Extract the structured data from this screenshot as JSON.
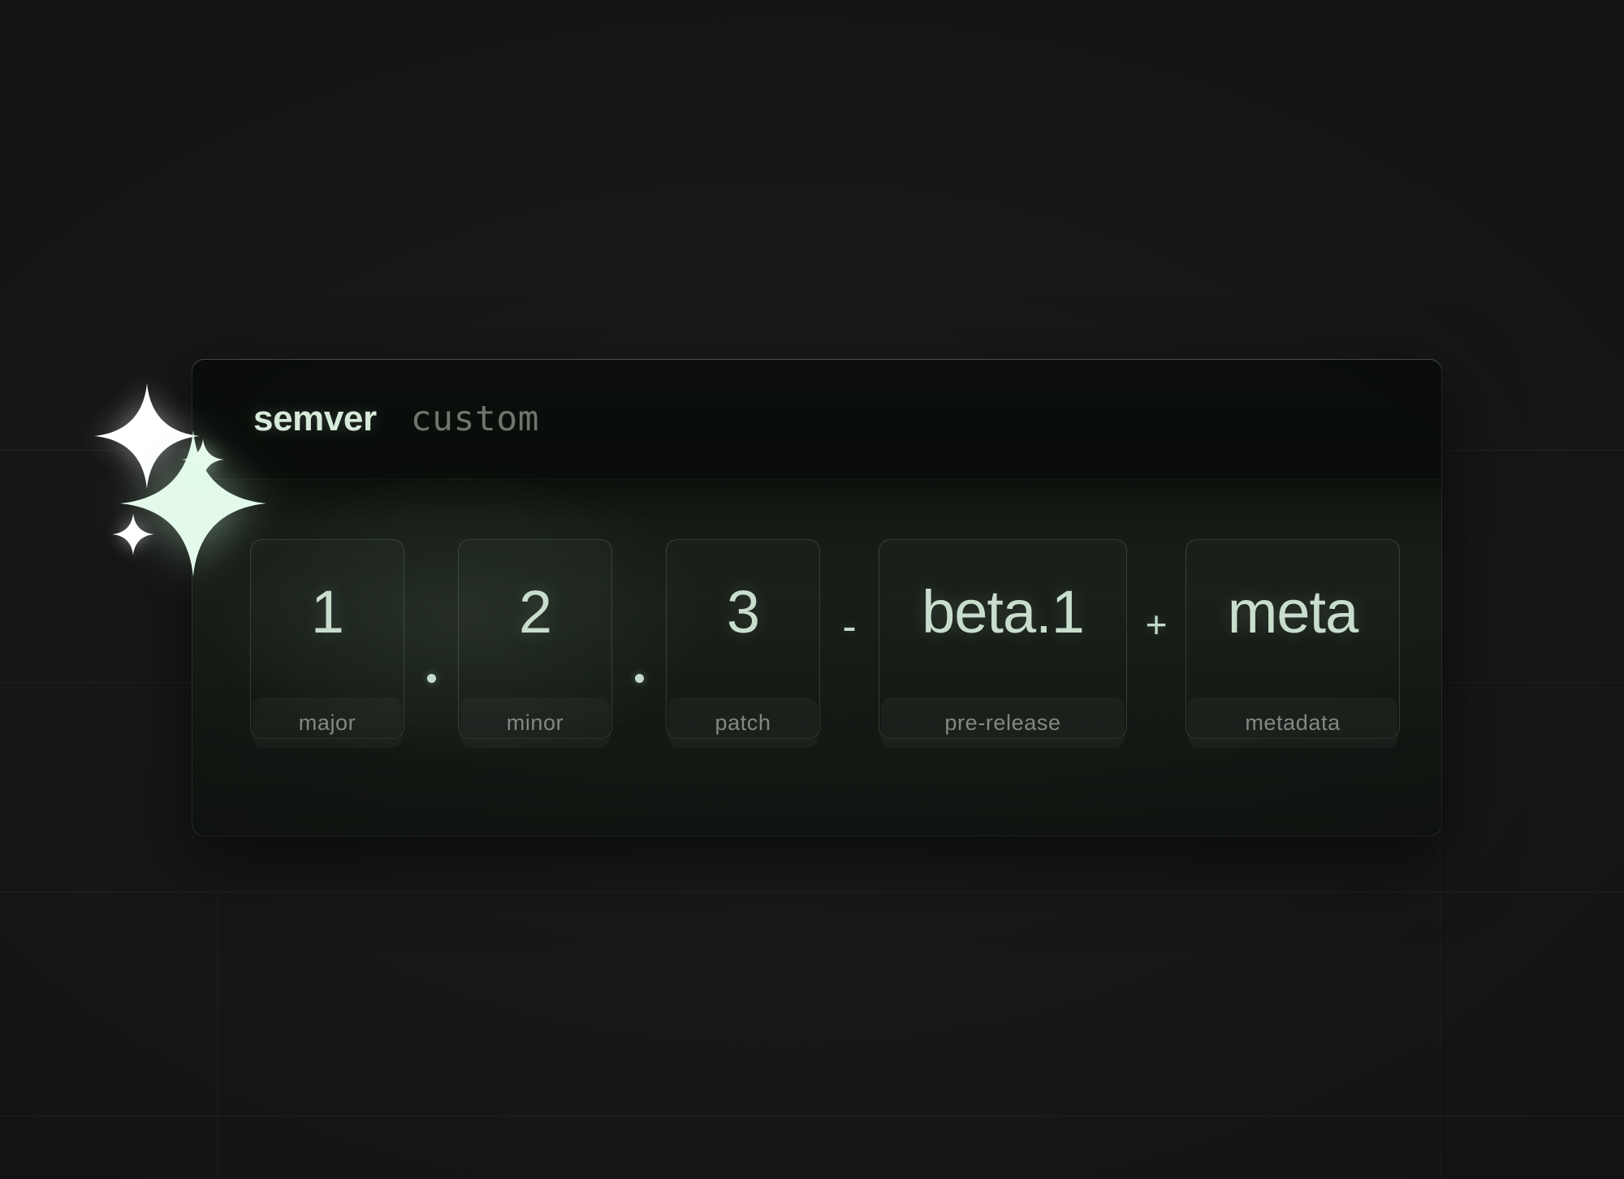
{
  "background": {
    "color": "#141414",
    "grid_color": "rgba(255,255,255,0.045)"
  },
  "theme": {
    "accent": "#c9ddcd",
    "accent_bright": "#d7ead9",
    "card_bg": "#141914",
    "label_text": "#848884",
    "inactive_tab": "#6f746f"
  },
  "card": {
    "tabs": [
      {
        "id": "semver",
        "label": "semver",
        "active": true
      },
      {
        "id": "custom",
        "label": "custom",
        "active": false
      }
    ],
    "version": {
      "fields": [
        {
          "id": "major",
          "value": "1",
          "label": "major",
          "width": "num"
        },
        {
          "id": "minor",
          "value": "2",
          "label": "minor",
          "width": "num"
        },
        {
          "id": "patch",
          "value": "3",
          "label": "patch",
          "width": "num"
        },
        {
          "id": "prerelease",
          "value": "beta.1",
          "label": "pre-release",
          "width": "pre"
        },
        {
          "id": "metadata",
          "value": "meta",
          "label": "metadata",
          "width": "meta"
        }
      ],
      "separators": {
        "dot": ".",
        "hyphen": "-",
        "plus": "+"
      },
      "composed": "1.2.3-beta.1+meta"
    }
  },
  "decoration": {
    "sparkles": [
      {
        "id": "sparkle-large-white",
        "color": "#ffffff"
      },
      {
        "id": "sparkle-large-mint",
        "color": "#dff7e6"
      },
      {
        "id": "sparkle-small-mint",
        "color": "#e2f7e9"
      },
      {
        "id": "sparkle-small-white",
        "color": "#ffffff"
      }
    ]
  }
}
